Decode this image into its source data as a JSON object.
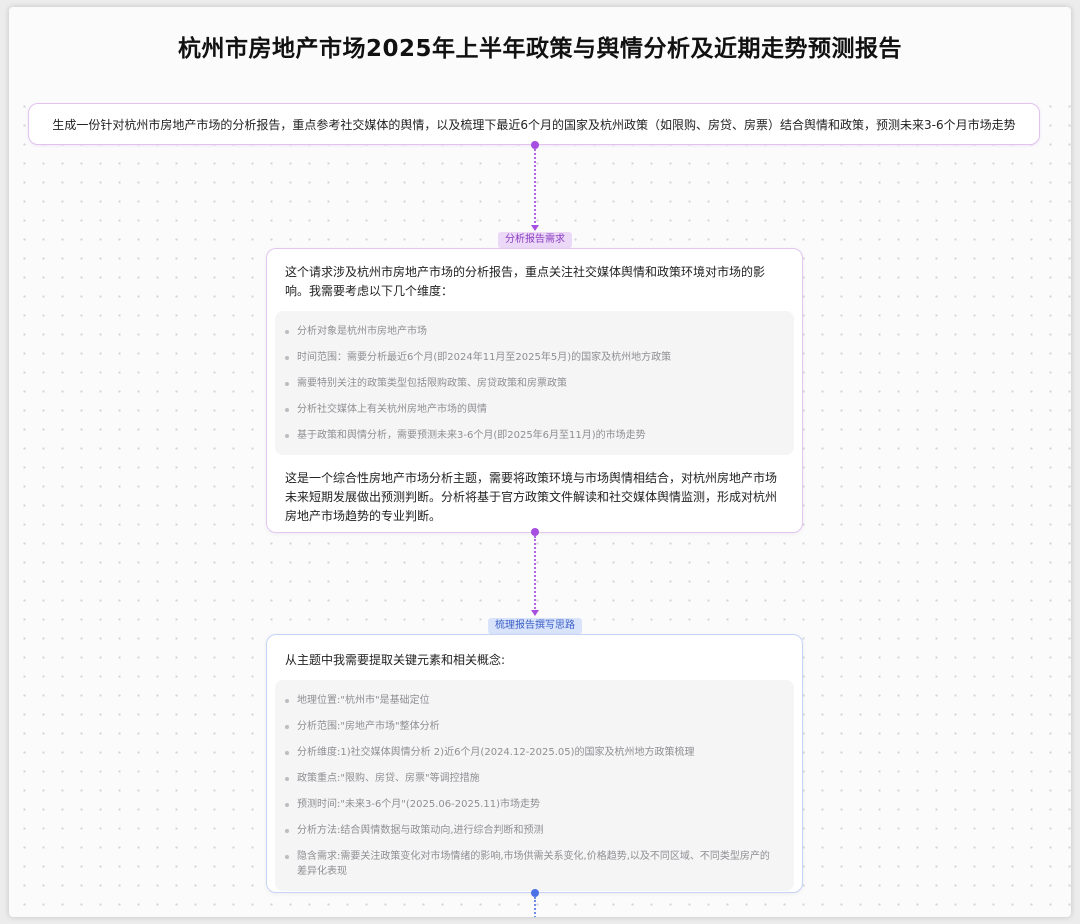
{
  "page": {
    "title": "杭州市房地产市场2025年上半年政策与舆情分析及近期走势预测报告"
  },
  "prompt": {
    "text": "生成一份针对杭州市房地产市场的分析报告，重点参考社交媒体的舆情，以及梳理下最近6个月的国家及杭州政策（如限购、房贷、房票）结合舆情和政策，预测未来3-6个月市场走势"
  },
  "step1": {
    "tag": "分析报告需求",
    "intro": "这个请求涉及杭州市房地产市场的分析报告，重点关注社交媒体舆情和政策环境对市场的影响。我需要考虑以下几个维度：",
    "items": [
      "分析对象是杭州市房地产市场",
      "时间范围：需要分析最近6个月(即2024年11月至2025年5月)的国家及杭州地方政策",
      "需要特别关注的政策类型包括限购政策、房贷政策和房票政策",
      "分析社交媒体上有关杭州房地产市场的舆情",
      "基于政策和舆情分析，需要预测未来3-6个月(即2025年6月至11月)的市场走势"
    ],
    "outro": "这是一个综合性房地产市场分析主题，需要将政策环境与市场舆情相结合，对杭州房地产市场未来短期发展做出预测判断。分析将基于官方政策文件解读和社交媒体舆情监测，形成对杭州房地产市场趋势的专业判断。"
  },
  "step2": {
    "tag": "梳理报告撰写思路",
    "intro": "从主题中我需要提取关键元素和相关概念:",
    "items": [
      "地理位置:\"杭州市\"是基础定位",
      "分析范围:\"房地产市场\"整体分析",
      "分析维度:1)社交媒体舆情分析 2)近6个月(2024.12-2025.05)的国家及杭州地方政策梳理",
      "政策重点:\"限购、房贷、房票\"等调控措施",
      "预测时间:\"未来3-6个月\"(2025.06-2025.11)市场走势",
      "分析方法:结合舆情数据与政策动向,进行综合判断和预测",
      "隐含需求:需要关注政策变化对市场情绪的影响,市场供需关系变化,价格趋势,以及不同区域、不同类型房产的差异化表现"
    ]
  },
  "colors": {
    "purple_accent": "#a64ee0",
    "blue_accent": "#4a72e6"
  }
}
